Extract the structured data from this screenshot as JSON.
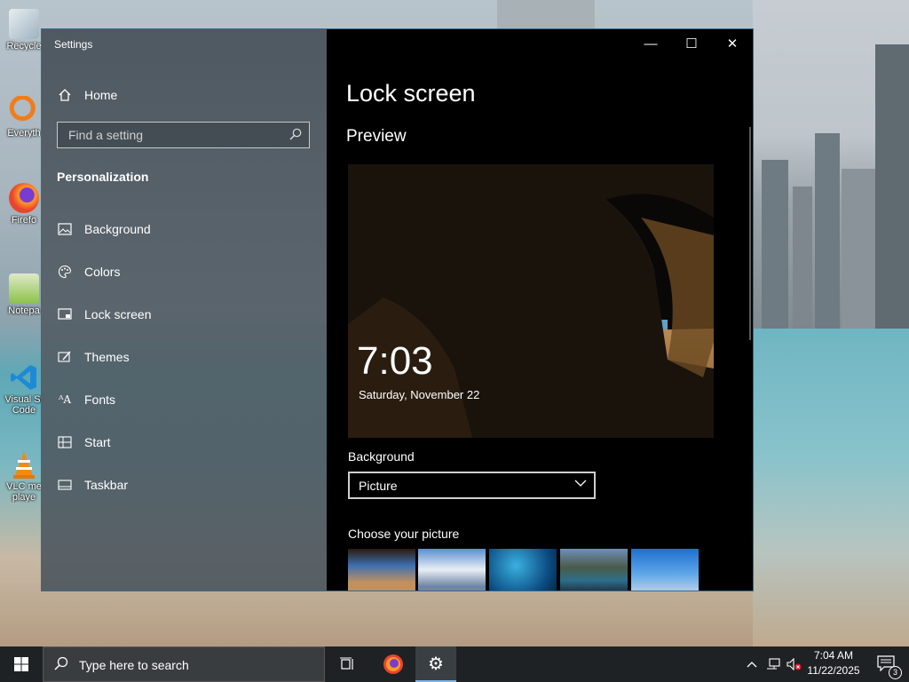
{
  "desktop": {
    "icons": [
      {
        "label": "Recycle",
        "icon": "recycle-bin-icon"
      },
      {
        "label": "Everyth",
        "icon": "everything-search-icon"
      },
      {
        "label": "Firefo",
        "icon": "firefox-icon"
      },
      {
        "label": "Notepa",
        "icon": "notepad-plus-plus-icon"
      },
      {
        "label": "Visual St",
        "label2": "Code",
        "icon": "vscode-icon"
      },
      {
        "label": "VLC me",
        "label2": "playe",
        "icon": "vlc-icon"
      }
    ]
  },
  "window": {
    "title": "Settings",
    "controls": {
      "minimize": "—",
      "maximize": "☐",
      "close": "✕"
    }
  },
  "nav": {
    "home_label": "Home",
    "search_placeholder": "Find a setting",
    "section_title": "Personalization",
    "items": [
      {
        "label": "Background",
        "icon": "picture-icon"
      },
      {
        "label": "Colors",
        "icon": "palette-icon"
      },
      {
        "label": "Lock screen",
        "icon": "lock-screen-icon"
      },
      {
        "label": "Themes",
        "icon": "themes-icon"
      },
      {
        "label": "Fonts",
        "icon": "fonts-icon"
      },
      {
        "label": "Start",
        "icon": "start-icon"
      },
      {
        "label": "Taskbar",
        "icon": "taskbar-icon"
      }
    ]
  },
  "content": {
    "page_title": "Lock screen",
    "preview_heading": "Preview",
    "preview_time": "7:03",
    "preview_date": "Saturday, November 22",
    "background_label": "Background",
    "background_value": "Picture",
    "choose_label": "Choose your picture"
  },
  "taskbar": {
    "search_placeholder": "Type here to search",
    "clock_time": "7:04 AM",
    "clock_date": "11/22/2025",
    "notification_count": "3"
  },
  "colors": {
    "accent": "#0078d7",
    "window_bg": "#000000",
    "taskbar_bg": "#1f2225"
  }
}
